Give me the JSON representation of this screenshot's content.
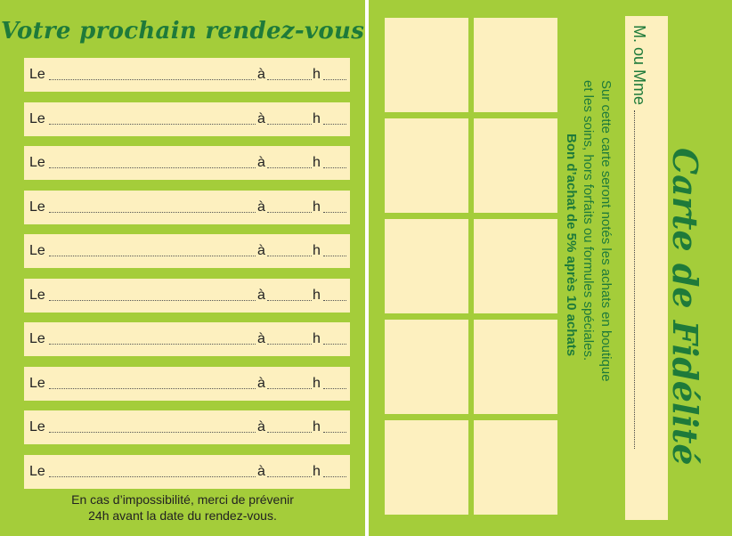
{
  "left": {
    "title": "Votre prochain rendez-vous",
    "rows": [
      {
        "le": "Le",
        "a": "à",
        "h": "h"
      },
      {
        "le": "Le",
        "a": "à",
        "h": "h"
      },
      {
        "le": "Le",
        "a": "à",
        "h": "h"
      },
      {
        "le": "Le",
        "a": "à",
        "h": "h"
      },
      {
        "le": "Le",
        "a": "à",
        "h": "h"
      },
      {
        "le": "Le",
        "a": "à",
        "h": "h"
      },
      {
        "le": "Le",
        "a": "à",
        "h": "h"
      },
      {
        "le": "Le",
        "a": "à",
        "h": "h"
      },
      {
        "le": "Le",
        "a": "à",
        "h": "h"
      },
      {
        "le": "Le",
        "a": "à",
        "h": "h"
      }
    ],
    "footer_line1": "En cas d’impossibilité, merci de prévenir",
    "footer_line2": "24h  avant la date du rendez-vous."
  },
  "right": {
    "title": "Carte de Fidélité",
    "name_label": "M. ou Mme",
    "desc_line1": "Sur cette carte seront notés les achats en boutique",
    "desc_line2": "et les soins, hors forfaits ou formules spéciales.",
    "bonus": "Bon d’achat de 5% après 10 achats",
    "stamp_count": 10
  },
  "colors": {
    "background": "#a4cd3a",
    "cream": "#fdf0bf",
    "title_green": "#1e7a3a"
  }
}
